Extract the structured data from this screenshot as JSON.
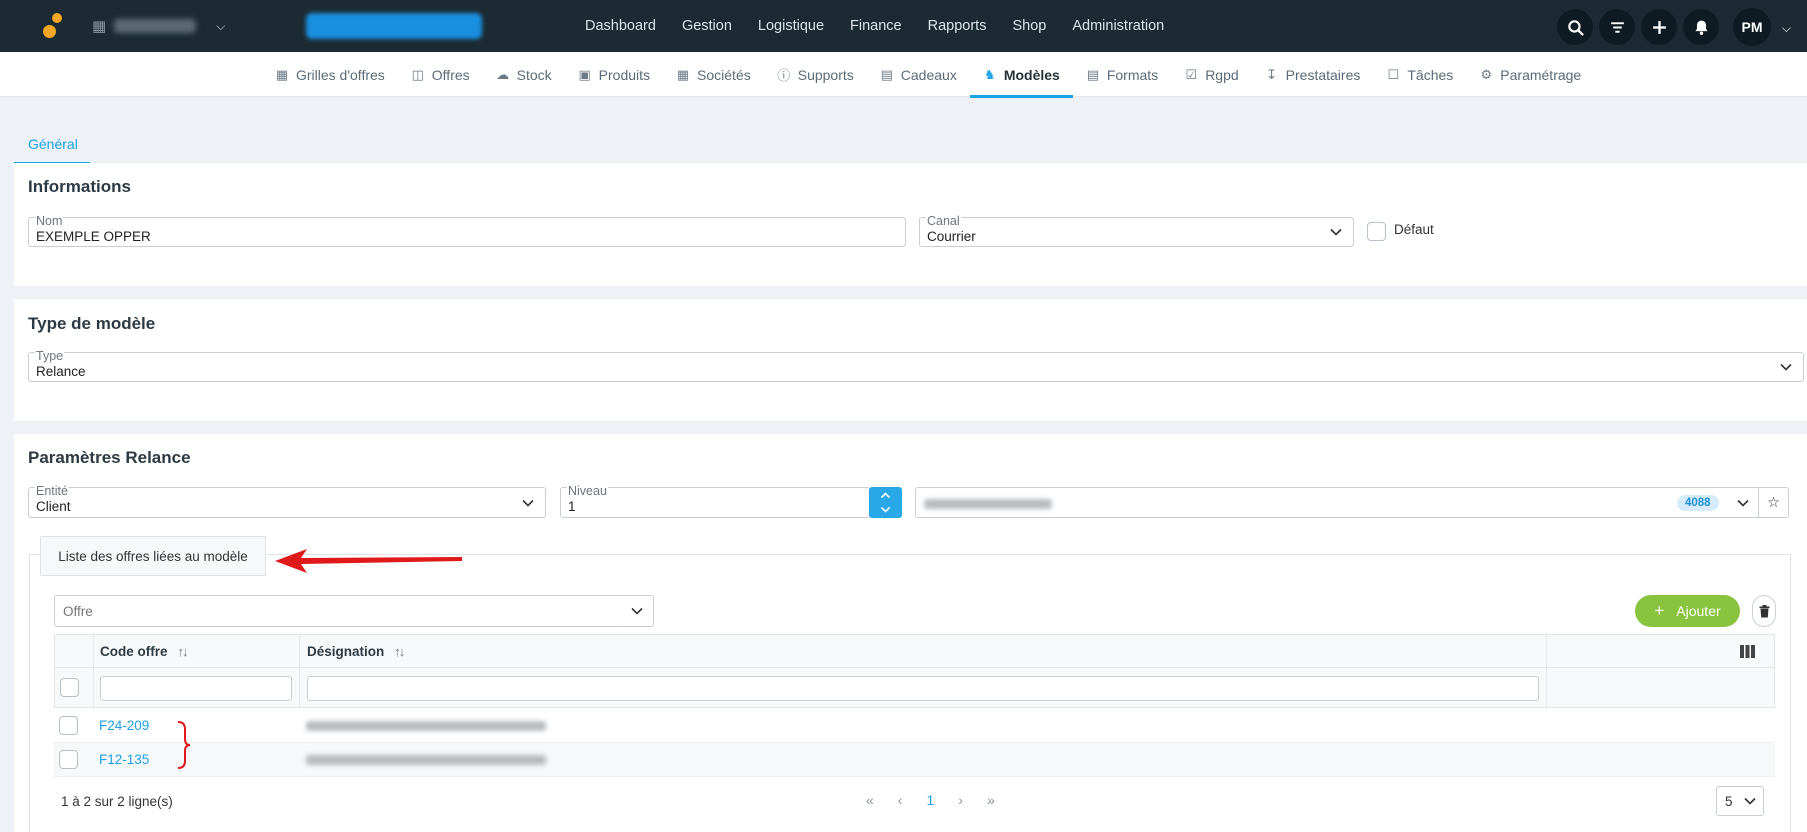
{
  "topbar": {
    "nav": [
      "Dashboard",
      "Gestion",
      "Logistique",
      "Finance",
      "Rapports",
      "Shop",
      "Administration"
    ],
    "avatar_initials": "PM",
    "icons": [
      "search-icon",
      "filter-icon",
      "plus-icon",
      "bell-icon"
    ]
  },
  "subnav": {
    "items": [
      {
        "label": "Grilles d'offres",
        "icon": "grid-icon"
      },
      {
        "label": "Offres",
        "icon": "book-icon"
      },
      {
        "label": "Stock",
        "icon": "cloud-icon"
      },
      {
        "label": "Produits",
        "icon": "cart-icon"
      },
      {
        "label": "Sociétés",
        "icon": "building-icon"
      },
      {
        "label": "Supports",
        "icon": "help-circle-icon"
      },
      {
        "label": "Cadeaux",
        "icon": "gift-icon"
      },
      {
        "label": "Modèles",
        "icon": "paint-roller-icon"
      },
      {
        "label": "Formats",
        "icon": "file-icon"
      },
      {
        "label": "Rgpd",
        "icon": "check-square-icon"
      },
      {
        "label": "Prestataires",
        "icon": "download-icon"
      },
      {
        "label": "Tâches",
        "icon": "calendar-check-icon"
      },
      {
        "label": "Paramétrage",
        "icon": "gear-icon"
      }
    ],
    "active": "Modèles"
  },
  "tabs": {
    "general": "Général"
  },
  "informations": {
    "title": "Informations",
    "nom_label": "Nom",
    "nom_value": "EXEMPLE OPPER",
    "canal_label": "Canal",
    "canal_value": "Courrier",
    "defaut_label": "Défaut"
  },
  "type_modele": {
    "title": "Type de modèle",
    "type_label": "Type",
    "type_value": "Relance"
  },
  "relance": {
    "title": "Paramètres Relance",
    "entite_label": "Entité",
    "entite_value": "Client",
    "niveau_label": "Niveau",
    "niveau_value": "1",
    "badge": "4088"
  },
  "offres": {
    "legend": "Liste des offres liées au modèle",
    "search_placeholder": "Offre",
    "add_label": "Ajouter",
    "columns": [
      "Code offre",
      "Désignation"
    ],
    "rows": [
      {
        "code": "F24-209"
      },
      {
        "code": "F12-135"
      }
    ],
    "pagination_text": "1 à 2 sur 2 ligne(s)",
    "current_page": "1",
    "page_size": "5",
    "accent": "#1da1e6",
    "add_color": "#8ac43f"
  }
}
